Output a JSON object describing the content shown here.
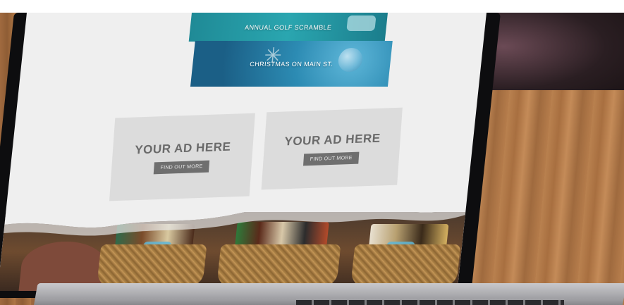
{
  "banners": {
    "golf": "ANNUAL GOLF SCRAMBLE",
    "christmas": "CHRISTMAS ON MAIN ST."
  },
  "ads": [
    {
      "title": "YOUR AD HERE",
      "button": "FIND OUT MORE"
    },
    {
      "title": "YOUR AD HERE",
      "button": "FIND OUT MORE"
    }
  ],
  "colors": {
    "banner_teal": "#2aa6b0",
    "banner_blue": "#2c8bb3",
    "ad_bg": "#dcdcdc",
    "ad_button": "#6f6f6f",
    "screen_bg": "#efefef"
  }
}
